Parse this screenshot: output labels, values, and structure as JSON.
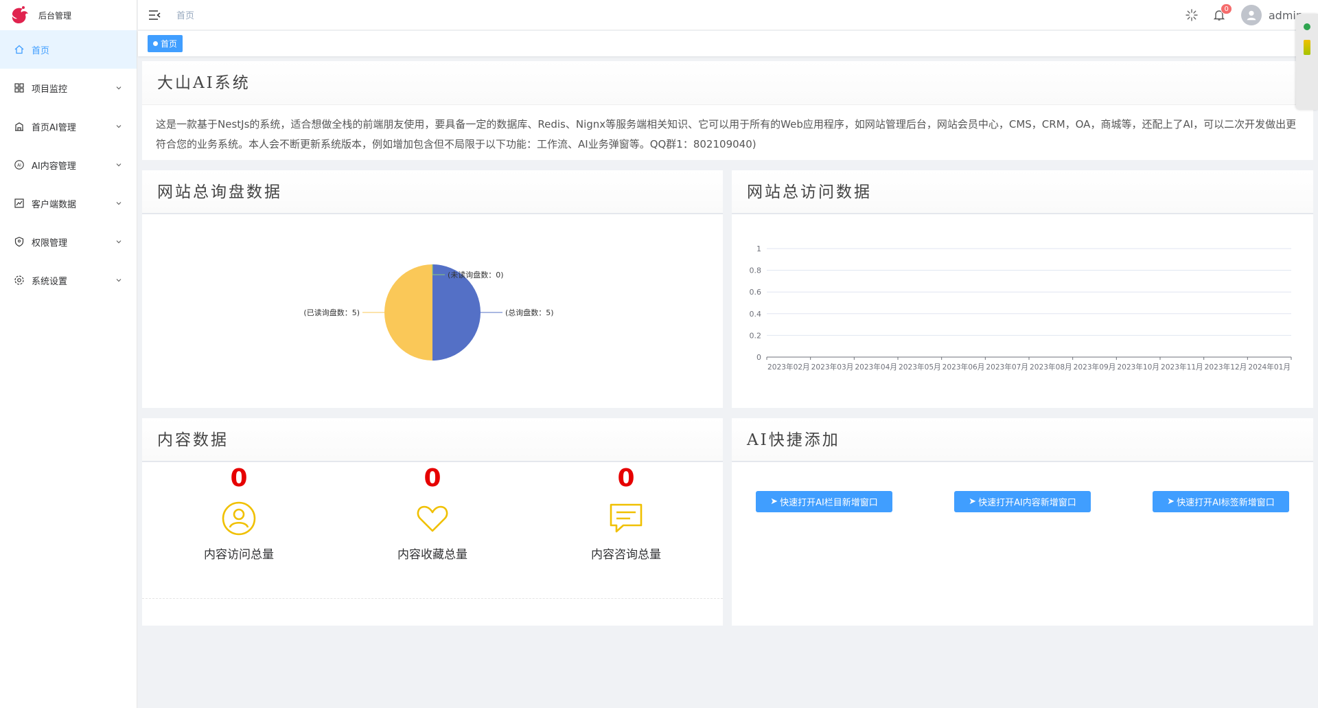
{
  "app": {
    "title": "后台管理"
  },
  "sidebar": {
    "items": [
      {
        "label": "首页",
        "icon": "home-icon",
        "active": true
      },
      {
        "label": "项目监控",
        "icon": "grid-icon"
      },
      {
        "label": "首页AI管理",
        "icon": "building-icon"
      },
      {
        "label": "AI内容管理",
        "icon": "ai-icon"
      },
      {
        "label": "客户端数据",
        "icon": "chart-line-icon"
      },
      {
        "label": "权限管理",
        "icon": "shield-icon"
      },
      {
        "label": "系统设置",
        "icon": "gear-icon"
      }
    ]
  },
  "header": {
    "breadcrumb": "首页",
    "notification_count": "0",
    "username": "admin"
  },
  "tags": [
    {
      "label": "首页"
    }
  ],
  "intro": {
    "title": "大山AI系统",
    "text": "这是一款基于NestJs的系统，适合想做全栈的前端朋友使用，要具备一定的数据库、Redis、Nignx等服务端相关知识、它可以用于所有的Web应用程序，如网站管理后台，网站会员中心，CMS，CRM，OA，商城等，还配上了AI，可以二次开发做出更符合您的业务系统。本人会不断更新系统版本，例如增加包含但不局限于以下功能：工作流、AI业务弹窗等。QQ群1：802109040)"
  },
  "panels": {
    "pie_title": "网站总询盘数据",
    "line_title": "网站总访问数据",
    "content_title": "内容数据",
    "quick_title": "AI快捷添加"
  },
  "chart_data": [
    {
      "type": "pie",
      "slices": [
        {
          "label": "(总询盘数：5)",
          "value": 5,
          "color": "#5470c6"
        },
        {
          "label": "(已读询盘数：5)",
          "value": 5,
          "color": "#fac858"
        },
        {
          "label": "(未读询盘数：0)",
          "value": 0,
          "color": "#91cc75"
        }
      ]
    },
    {
      "type": "line",
      "categories": [
        "2023年02月",
        "2023年03月",
        "2023年04月",
        "2023年05月",
        "2023年06月",
        "2023年07月",
        "2023年08月",
        "2023年09月",
        "2023年10月",
        "2023年11月",
        "2023年12月",
        "2024年01月"
      ],
      "y_ticks": [
        "0",
        "0.2",
        "0.4",
        "0.6",
        "0.8",
        "1"
      ],
      "ylim": [
        0,
        1
      ],
      "grid": true
    }
  ],
  "content_stats": [
    {
      "value": "0",
      "label": "内容访问总量",
      "icon": "user-icon"
    },
    {
      "value": "0",
      "label": "内容收藏总量",
      "icon": "heart-icon"
    },
    {
      "value": "0",
      "label": "内容咨询总量",
      "icon": "message-icon"
    }
  ],
  "quick_add": [
    {
      "label": "快速打开AI栏目新增窗口"
    },
    {
      "label": "快速打开AI内容新增窗口"
    },
    {
      "label": "快速打开AI标签新增窗口"
    }
  ],
  "colors": {
    "primary": "#409eff",
    "stat_number": "#e60000",
    "stat_icon": "#f0c000"
  }
}
